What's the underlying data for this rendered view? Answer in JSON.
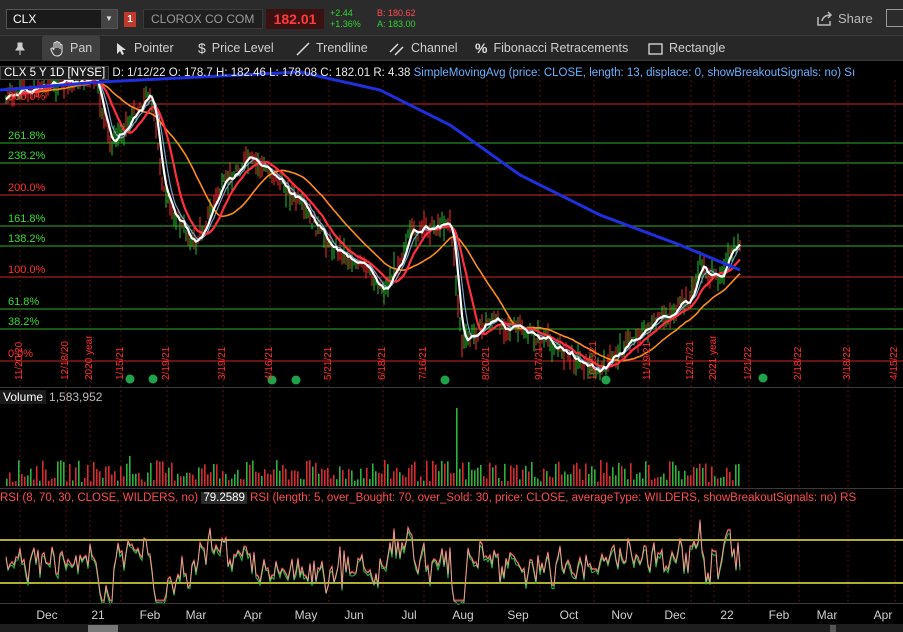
{
  "topbar": {
    "symbol": "CLX",
    "alert_flag": "1",
    "company": "CLOROX CO COM",
    "last_price": "182.01",
    "change_abs": "+2.44",
    "change_pct": "+1.36%",
    "bid": "B: 180.62",
    "ask": "A: 183.00",
    "share_label": "Share"
  },
  "toolbar": {
    "pan": "Pan",
    "pointer": "Pointer",
    "price_level": "Price Level",
    "trendline": "Trendline",
    "channel": "Channel",
    "fibonacci": "Fibonacci Retracements",
    "rectangle": "Rectangle"
  },
  "header": {
    "symbol_period": "CLX 5 Y 1D [NYSE]",
    "d": "D: 1/12/22",
    "o": "O: 178.7",
    "h": "H: 182.46",
    "l": "L: 178.08",
    "c": "C: 182.01",
    "r": "R: 4.38",
    "sma": "SimpleMovingAvg (price: CLOSE, length: 13, displace: 0, showBreakoutSignals: no)",
    "overflow": "Sı"
  },
  "fib_levels": [
    {
      "label": "300.0%",
      "color": "#ff3030"
    },
    {
      "label": "261.8%",
      "color": "#33dd33"
    },
    {
      "label": "238.2%",
      "color": "#33dd33"
    },
    {
      "label": "200.0%",
      "color": "#ff3030"
    },
    {
      "label": "161.8%",
      "color": "#33dd33"
    },
    {
      "label": "138.2%",
      "color": "#33dd33"
    },
    {
      "label": "100.0%",
      "color": "#ff3030"
    },
    {
      "label": "61.8%",
      "color": "#33dd33"
    },
    {
      "label": "38.2%",
      "color": "#33dd33"
    },
    {
      "label": "0.0%",
      "color": "#ff3030"
    }
  ],
  "date_markers": [
    "11/20/20",
    "12/18/20",
    "2020 year",
    "1/15/21",
    "2/19/21",
    "3/19/21",
    "4/16/21",
    "5/21/21",
    "6/18/21",
    "7/16/21",
    "8/20/21",
    "9/17/21",
    "10/15/21",
    "11/19/21",
    "12/17/21",
    "2021 year",
    "1/21/22",
    "2/18/22",
    "3/18/22",
    "4/15/22"
  ],
  "volume": {
    "label": "Volume",
    "value": "1,583,952"
  },
  "rsi": {
    "label": "RSI (8, 70, 30, CLOSE, WILDERS, no)",
    "value": "79.2589",
    "label2": "RSI (length: 5, over_Bought: 70, over_Sold: 30, price: CLOSE, averageType: WILDERS, showBreakoutSignals: no)",
    "overflow": "RS"
  },
  "x_axis": [
    "Dec",
    "21",
    "Feb",
    "Mar",
    "Apr",
    "May",
    "Jun",
    "Jul",
    "Aug",
    "Sep",
    "Oct",
    "Nov",
    "Dec",
    "22",
    "Feb",
    "Mar",
    "Apr"
  ],
  "colors": {
    "sma_200": "#1f2fdd",
    "sma_50": "#ff8c1a",
    "sma_20": "#ff2e3e",
    "sma_13": "#ffffff",
    "sma_5": "#7aa0c8",
    "candle_up": "#22c22a",
    "candle_down": "#ff2a2a",
    "rsi_band": "#e7e83a"
  }
}
